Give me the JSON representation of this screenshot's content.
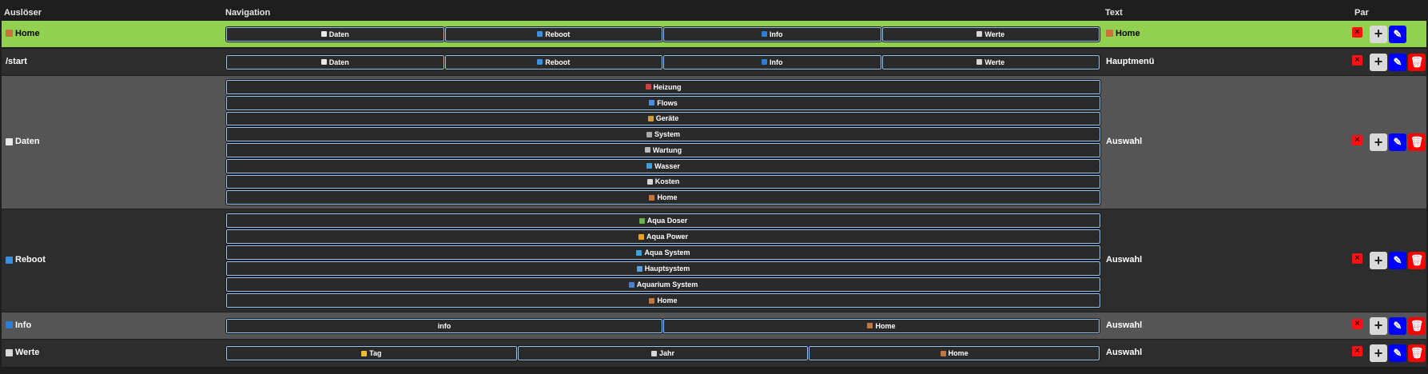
{
  "header": {
    "col_trigger": "Auslöser",
    "col_navigation": "Navigation",
    "col_text": "Text",
    "col_par": "Par"
  },
  "colors": {
    "active_row": "#92d050",
    "row_dark": "#2d2d2d",
    "row_light": "#555555",
    "button_border": "#9ac4f0",
    "edit": "#0000ff",
    "delete": "#ff0000"
  },
  "rows": [
    {
      "trigger": "Home",
      "trigger_icon": "home-icon",
      "text": "Home",
      "text_icon": "home-icon",
      "nav": [
        "Daten",
        "Reboot",
        "Info",
        "Werte"
      ],
      "nav_icons": [
        "document-icon",
        "reboot-icon",
        "info-icon",
        "chart-icon"
      ]
    },
    {
      "trigger": "/start",
      "text": "Hauptmenü",
      "nav": [
        "Daten",
        "Reboot",
        "Info",
        "Werte"
      ],
      "nav_icons": [
        "document-icon",
        "reboot-icon",
        "info-icon",
        "chart-icon"
      ]
    },
    {
      "trigger": "Daten",
      "trigger_icon": "document-icon",
      "text": "Auswahl",
      "nav": [
        "Heizung",
        "Flows",
        "Geräte",
        "System",
        "Wartung",
        "Wasser",
        "Kosten",
        "Home"
      ],
      "nav_icons": [
        "thermometer-icon",
        "flows-icon",
        "tools-icon",
        "gear-icon",
        "wrench-icon",
        "water-icon",
        "chart-icon",
        "home-icon"
      ]
    },
    {
      "trigger": "Reboot",
      "trigger_icon": "reboot-icon",
      "text": "Auswahl",
      "nav": [
        "Aqua Doser",
        "Aqua Power",
        "Aqua System",
        "Hauptsystem",
        "Aquarium System",
        "Home"
      ],
      "nav_icons": [
        "syringe-icon",
        "lightning-icon",
        "water-icon",
        "monitor-icon",
        "globe-icon",
        "home-icon"
      ]
    },
    {
      "trigger": "Info",
      "trigger_icon": "info-icon",
      "text": "Auswahl",
      "nav": [
        "info",
        "Home"
      ],
      "nav_icons": [
        "",
        "home-icon"
      ]
    },
    {
      "trigger": "Werte",
      "trigger_icon": "chart-icon",
      "text": "Auswahl",
      "nav": [
        "Tag",
        "Jahr",
        "Home"
      ],
      "nav_icons": [
        "sun-icon",
        "calendar-icon",
        "home-icon"
      ]
    }
  ],
  "actions": {
    "close": "×",
    "add": "+",
    "edit": "✎",
    "delete": "🗑"
  }
}
